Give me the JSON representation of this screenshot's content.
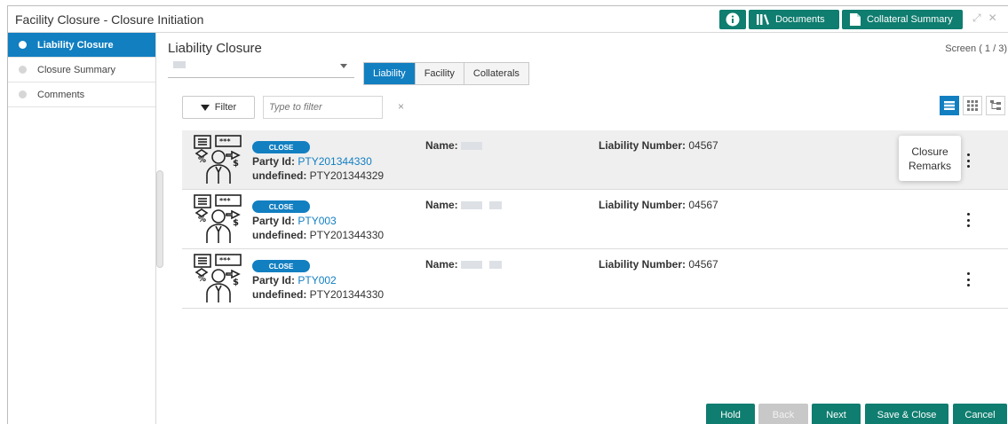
{
  "window": {
    "title": "Facility Closure - Closure Initiation",
    "info_label": "i",
    "documents_label": "Documents",
    "collateral_summary_label": "Collateral Summary"
  },
  "sidebar": {
    "items": [
      {
        "label": "Liability Closure",
        "active": true
      },
      {
        "label": "Closure Summary",
        "active": false
      },
      {
        "label": "Comments",
        "active": false
      }
    ]
  },
  "main": {
    "title": "Liability Closure",
    "screen_count": "Screen ( 1 / 3)",
    "tabs": [
      "Liability",
      "Facility",
      "Collaterals"
    ],
    "active_tab": "Liability",
    "filter_label": "Filter",
    "filter_placeholder": "Type to filter",
    "clear_label": "×"
  },
  "rows": [
    {
      "badge": "CLOSE",
      "party_label": "Party Id:",
      "party_id": "PTY201344330",
      "undef_label": "undefined:",
      "undef_value": "PTY201344329",
      "name_label": "Name:",
      "liability_label": "Liability Number:",
      "liability_number": "04567"
    },
    {
      "badge": "CLOSE",
      "party_label": "Party Id:",
      "party_id": "PTY003",
      "undef_label": "undefined:",
      "undef_value": "PTY201344330",
      "name_label": "Name:",
      "liability_label": "Liability Number:",
      "liability_number": "04567"
    },
    {
      "badge": "CLOSE",
      "party_label": "Party Id:",
      "party_id": "PTY002",
      "undef_label": "undefined:",
      "undef_value": "PTY201344330",
      "name_label": "Name:",
      "liability_label": "Liability Number:",
      "liability_number": "04567"
    }
  ],
  "popover": {
    "line1": "Closure",
    "line2": "Remarks"
  },
  "footer": {
    "hold": "Hold",
    "back": "Back",
    "next": "Next",
    "save_close": "Save & Close",
    "cancel": "Cancel"
  },
  "colors": {
    "primary_blue": "#127fc1",
    "action_teal": "#0f7d6f",
    "disabled_gray": "#c8c8c8"
  }
}
